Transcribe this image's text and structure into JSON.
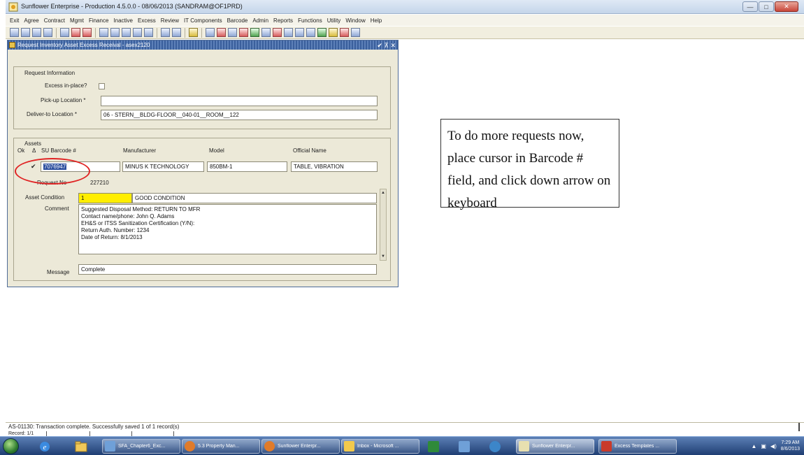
{
  "app": {
    "title": "Sunflower Enterprise - Production 4.5.0.0 - 08/06/2013 (SANDRAM@OF1PRD)",
    "window_controls": {
      "minimize": "—",
      "maximize": "□",
      "close": "✕"
    }
  },
  "menu": [
    "Exit",
    "Agree",
    "Contract",
    "Mgmt",
    "Finance",
    "Inactive",
    "Excess",
    "Review",
    "IT Components",
    "Barcode",
    "Admin",
    "Reports",
    "Functions",
    "Utility",
    "Window",
    "Help"
  ],
  "child_window": {
    "title": "Request Inventory Asset Excess Receival - asex2120",
    "controls": "✔ ⊼ ✕"
  },
  "request_info": {
    "group_label": "Request Information",
    "excess_in_place_label": "Excess in-place?",
    "pickup_label": "Pick-up Location *",
    "pickup_value": "",
    "deliver_label": "Deliver-to Location *",
    "deliver_value": "06 - STERN__BLDG-FLOOR__040-01__ROOM__122"
  },
  "assets": {
    "group_label": "Assets",
    "col_ok": "Ok",
    "col_delta": "Δ",
    "col_barcode": "SU Barcode #",
    "col_manufacturer": "Manufacturer",
    "col_model": "Model",
    "col_official_name": "Official Name",
    "check_mark": "✔",
    "barcode": "7076947",
    "manufacturer": "MINUS K TECHNOLOGY",
    "model": "850BM-1",
    "official_name": "TABLE, VIBRATION",
    "request_no_label": "Request No",
    "request_no": "227210",
    "condition_label": "Asset Condition",
    "condition_code": "1",
    "condition_text": "GOOD CONDITION",
    "comment_label": "Comment",
    "comment_lines": [
      "Suggested Disposal Method: RETURN TO MFR",
      "Contact name/phone: John Q. Adams",
      "EH&S or ITSS Sanitization Certification (Y/N):",
      "Return Auth. Number: 1234",
      "Date of Return: 8/1/2013"
    ],
    "message_label": "Message",
    "message_value": "Complete"
  },
  "callout_text": "To do more requests now, place cursor in Barcode # field, and click down arrow on keyboard",
  "status": {
    "message": "AS-01130: Transaction complete. Successfully saved 1 of 1 record(s)",
    "record": "Record: 1/1"
  },
  "taskbar": {
    "tasks": [
      {
        "label": "SFA_Chapter6_Exc...",
        "color": "#6fa0d8"
      },
      {
        "label": "5.3 Property Man...",
        "color": "#e07b2a"
      },
      {
        "label": "Sunflower Enterpr...",
        "color": "#e07b2a"
      },
      {
        "label": "Inbox - Microsoft ...",
        "color": "#f2c94c"
      },
      {
        "label": "",
        "color": "#2f8a3a"
      },
      {
        "label": "",
        "color": "#6fa0d8"
      },
      {
        "label": "",
        "color": "#3c86c9"
      },
      {
        "label": "Sunflower Enterpr...",
        "color": "#e8e0b0"
      },
      {
        "label": "Excess Templates ...",
        "color": "#c93a2a"
      }
    ],
    "clock_time": "7:29 AM",
    "clock_date": "8/6/2013"
  }
}
